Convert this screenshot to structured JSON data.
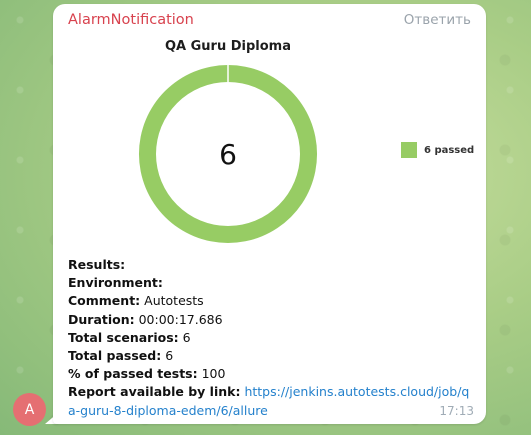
{
  "message": {
    "sender": "AlarmNotification",
    "reply_label": "Ответить",
    "time": "17:13",
    "avatar_letter": "A",
    "avatar_color": "#e56f72"
  },
  "chart_data": {
    "type": "pie",
    "title": "QA Guru Diploma",
    "center_label": "6",
    "categories": [
      "6 passed"
    ],
    "values": [
      6
    ],
    "colors": [
      "#97cc64"
    ],
    "legend_position": "right"
  },
  "details": {
    "results_label": "Results:",
    "environment_label": "Environment:",
    "comment_label": "Comment:",
    "comment_value": "Autotests",
    "duration_label": "Duration:",
    "duration_value": "00:00:17.686",
    "total_scenarios_label": "Total scenarios:",
    "total_scenarios_value": "6",
    "total_passed_label": "Total passed:",
    "total_passed_value": "6",
    "percent_passed_label": "% of passed tests:",
    "percent_passed_value": "100",
    "report_label": "Report available by link:",
    "report_link": "https://jenkins.autotests.cloud/job/qa-guru-8-diploma-edem/6/allure"
  }
}
